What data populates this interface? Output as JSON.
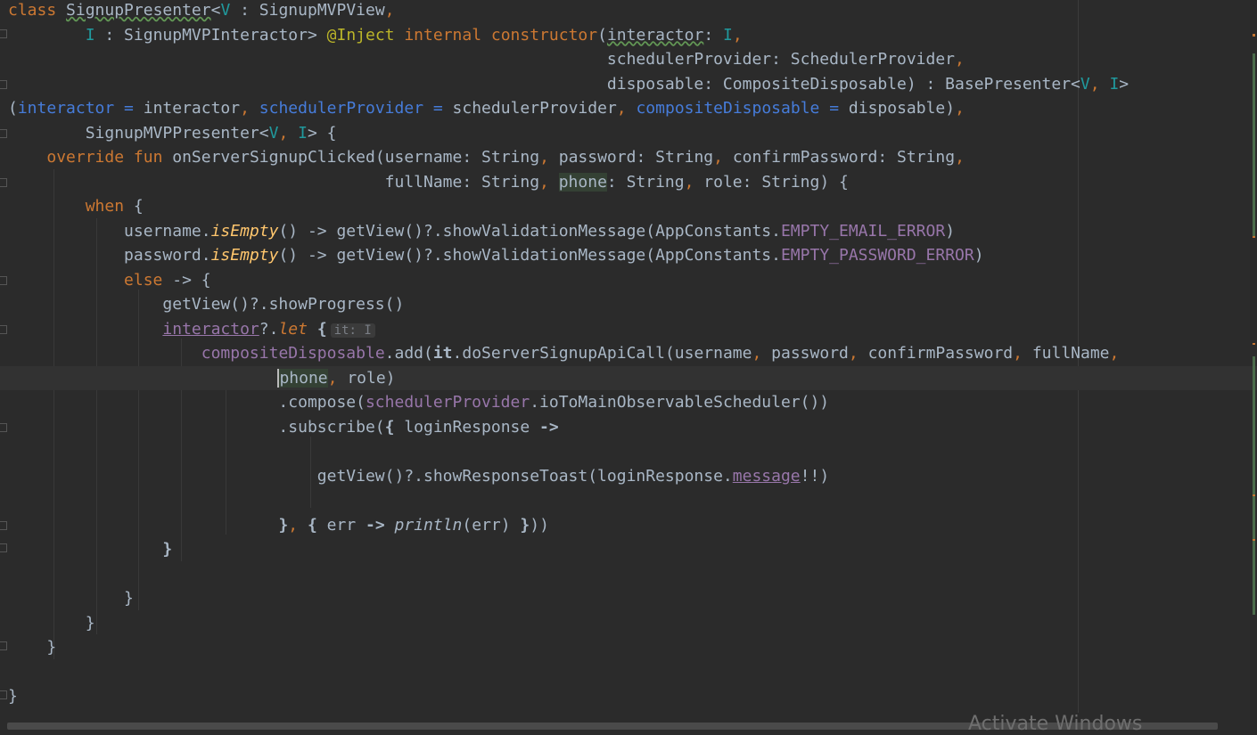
{
  "editor": {
    "language": "kotlin",
    "colors": {
      "background": "#2b2b2b",
      "keyword": "#cc7832",
      "property": "#9876aa",
      "function_call": "#ffc66d",
      "annotation": "#bbb529",
      "type_param": "#20999d",
      "named_argument": "#467cda",
      "text": "#a9b7c6"
    },
    "lines": [
      {
        "tokens": [
          {
            "t": "class ",
            "c": "kw"
          },
          {
            "t": "SignupPresenter",
            "c": "wavy"
          },
          {
            "t": "<",
            "c": "plain"
          },
          {
            "t": "V",
            "c": "gen"
          },
          {
            "t": " : SignupMVPView",
            "c": "plain"
          },
          {
            "t": ",",
            "c": "kw"
          }
        ]
      },
      {
        "tokens": [
          {
            "t": "        ",
            "c": "plain"
          },
          {
            "t": "I",
            "c": "gen"
          },
          {
            "t": " : SignupMVPInteractor> ",
            "c": "plain"
          },
          {
            "t": "@Inject ",
            "c": "ann"
          },
          {
            "t": "internal constructor",
            "c": "kw"
          },
          {
            "t": "(",
            "c": "plain"
          },
          {
            "t": "interactor",
            "c": "wavy"
          },
          {
            "t": ": ",
            "c": "plain"
          },
          {
            "t": "I",
            "c": "gen"
          },
          {
            "t": ",",
            "c": "kw"
          }
        ]
      },
      {
        "tokens": [
          {
            "t": "                                                              schedulerProvider: SchedulerProvider",
            "c": "plain"
          },
          {
            "t": ",",
            "c": "kw"
          }
        ]
      },
      {
        "tokens": [
          {
            "t": "                                                              disposable: CompositeDisposable) : BasePresenter<",
            "c": "plain"
          },
          {
            "t": "V",
            "c": "gen"
          },
          {
            "t": ", ",
            "c": "kw"
          },
          {
            "t": "I",
            "c": "gen"
          },
          {
            "t": ">",
            "c": "plain"
          }
        ]
      },
      {
        "tokens": [
          {
            "t": "(",
            "c": "plain"
          },
          {
            "t": "interactor = ",
            "c": "named"
          },
          {
            "t": "interactor",
            "c": "plain"
          },
          {
            "t": ", ",
            "c": "kw"
          },
          {
            "t": "schedulerProvider = ",
            "c": "named"
          },
          {
            "t": "schedulerProvider",
            "c": "plain"
          },
          {
            "t": ", ",
            "c": "kw"
          },
          {
            "t": "compositeDisposable = ",
            "c": "named"
          },
          {
            "t": "disposable)",
            "c": "plain"
          },
          {
            "t": ",",
            "c": "kw"
          }
        ]
      },
      {
        "tokens": [
          {
            "t": "        SignupMVPPresenter<",
            "c": "plain"
          },
          {
            "t": "V",
            "c": "gen"
          },
          {
            "t": ", ",
            "c": "kw"
          },
          {
            "t": "I",
            "c": "gen"
          },
          {
            "t": "> {",
            "c": "plain"
          }
        ]
      },
      {
        "tokens": [
          {
            "t": "    ",
            "c": "plain"
          },
          {
            "t": "override fun ",
            "c": "kw"
          },
          {
            "t": "onServerSignupClicked(username: String",
            "c": "plain"
          },
          {
            "t": ", ",
            "c": "kw"
          },
          {
            "t": "password: String",
            "c": "plain"
          },
          {
            "t": ", ",
            "c": "kw"
          },
          {
            "t": "confirmPassword: String",
            "c": "plain"
          },
          {
            "t": ",",
            "c": "kw"
          }
        ]
      },
      {
        "tokens": [
          {
            "t": "                                       fullName: String",
            "c": "plain"
          },
          {
            "t": ", ",
            "c": "kw"
          },
          {
            "t": "phone",
            "c": "usage"
          },
          {
            "t": ": String",
            "c": "plain"
          },
          {
            "t": ", ",
            "c": "kw"
          },
          {
            "t": "role: String) {",
            "c": "plain"
          }
        ]
      },
      {
        "tokens": [
          {
            "t": "        ",
            "c": "plain"
          },
          {
            "t": "when ",
            "c": "kw"
          },
          {
            "t": "{",
            "c": "plain"
          }
        ]
      },
      {
        "tokens": [
          {
            "t": "            username.",
            "c": "plain"
          },
          {
            "t": "isEmpty",
            "c": "fnit"
          },
          {
            "t": "() -> getView()?.showValidationMessage(AppConstants.",
            "c": "plain"
          },
          {
            "t": "EMPTY_EMAIL_ERROR",
            "c": "prop"
          },
          {
            "t": ")",
            "c": "plain"
          }
        ]
      },
      {
        "tokens": [
          {
            "t": "            password.",
            "c": "plain"
          },
          {
            "t": "isEmpty",
            "c": "fnit"
          },
          {
            "t": "() -> getView()?.showValidationMessage(AppConstants.",
            "c": "plain"
          },
          {
            "t": "EMPTY_PASSWORD_ERROR",
            "c": "prop"
          },
          {
            "t": ")",
            "c": "plain"
          }
        ]
      },
      {
        "tokens": [
          {
            "t": "            ",
            "c": "plain"
          },
          {
            "t": "else ",
            "c": "kw"
          },
          {
            "t": "-> {",
            "c": "plain"
          }
        ]
      },
      {
        "tokens": [
          {
            "t": "                getView()?.showProgress()",
            "c": "plain"
          }
        ]
      },
      {
        "tokens": [
          {
            "t": "                ",
            "c": "plain"
          },
          {
            "t": "interactor",
            "c": "propu"
          },
          {
            "t": "?.",
            "c": "plain"
          },
          {
            "t": "let ",
            "c": "kwit"
          },
          {
            "t": "{",
            "c": "bold"
          },
          {
            "t": "it: I",
            "c": "hint"
          }
        ]
      },
      {
        "tokens": [
          {
            "t": "                    ",
            "c": "plain"
          },
          {
            "t": "compositeDisposable",
            "c": "prop"
          },
          {
            "t": ".add(",
            "c": "plain"
          },
          {
            "t": "it",
            "c": "bold"
          },
          {
            "t": ".doServerSignupApiCall(username",
            "c": "plain"
          },
          {
            "t": ", ",
            "c": "kw"
          },
          {
            "t": "password",
            "c": "plain"
          },
          {
            "t": ", ",
            "c": "kw"
          },
          {
            "t": "confirmPassword",
            "c": "plain"
          },
          {
            "t": ", ",
            "c": "kw"
          },
          {
            "t": "fullName",
            "c": "plain"
          },
          {
            "t": ",",
            "c": "kw"
          }
        ]
      },
      {
        "current": true,
        "tokens": [
          {
            "t": "                            ",
            "c": "plain"
          },
          {
            "t": "p",
            "c": "caretusage"
          },
          {
            "t": "hone",
            "c": "usage"
          },
          {
            "t": ", ",
            "c": "kw"
          },
          {
            "t": "role)",
            "c": "plain"
          }
        ]
      },
      {
        "tokens": [
          {
            "t": "                            .compose(",
            "c": "plain"
          },
          {
            "t": "schedulerProvider",
            "c": "prop"
          },
          {
            "t": ".ioToMainObservableScheduler())",
            "c": "plain"
          }
        ]
      },
      {
        "tokens": [
          {
            "t": "                            .subscribe(",
            "c": "plain"
          },
          {
            "t": "{ ",
            "c": "bold"
          },
          {
            "t": "loginResponse ",
            "c": "plain"
          },
          {
            "t": "->",
            "c": "bold"
          }
        ]
      },
      {
        "tokens": [
          {
            "t": "",
            "c": "plain"
          }
        ]
      },
      {
        "tokens": [
          {
            "t": "                                getView()?.showResponseToast(loginResponse.",
            "c": "plain"
          },
          {
            "t": "message",
            "c": "propu"
          },
          {
            "t": "!!)",
            "c": "plain"
          }
        ]
      },
      {
        "tokens": [
          {
            "t": "",
            "c": "plain"
          }
        ]
      },
      {
        "tokens": [
          {
            "t": "                            ",
            "c": "plain"
          },
          {
            "t": "}",
            "c": "bold"
          },
          {
            "t": ", ",
            "c": "kw"
          },
          {
            "t": "{ ",
            "c": "bold"
          },
          {
            "t": "err ",
            "c": "plain"
          },
          {
            "t": "-> ",
            "c": "bold"
          },
          {
            "t": "println",
            "c": "italic"
          },
          {
            "t": "(err) ",
            "c": "plain"
          },
          {
            "t": "}",
            "c": "bold"
          },
          {
            "t": "))",
            "c": "plain"
          }
        ]
      },
      {
        "tokens": [
          {
            "t": "                ",
            "c": "plain"
          },
          {
            "t": "}",
            "c": "bold"
          }
        ]
      },
      {
        "tokens": [
          {
            "t": "",
            "c": "plain"
          }
        ]
      },
      {
        "tokens": [
          {
            "t": "            }",
            "c": "plain"
          }
        ]
      },
      {
        "tokens": [
          {
            "t": "        }",
            "c": "plain"
          }
        ]
      },
      {
        "tokens": [
          {
            "t": "    }",
            "c": "plain"
          }
        ]
      },
      {
        "tokens": [
          {
            "t": "",
            "c": "plain"
          }
        ]
      },
      {
        "tokens": [
          {
            "t": "}",
            "c": "plain"
          }
        ]
      }
    ]
  },
  "watermark": {
    "text": "Activate Windows"
  }
}
